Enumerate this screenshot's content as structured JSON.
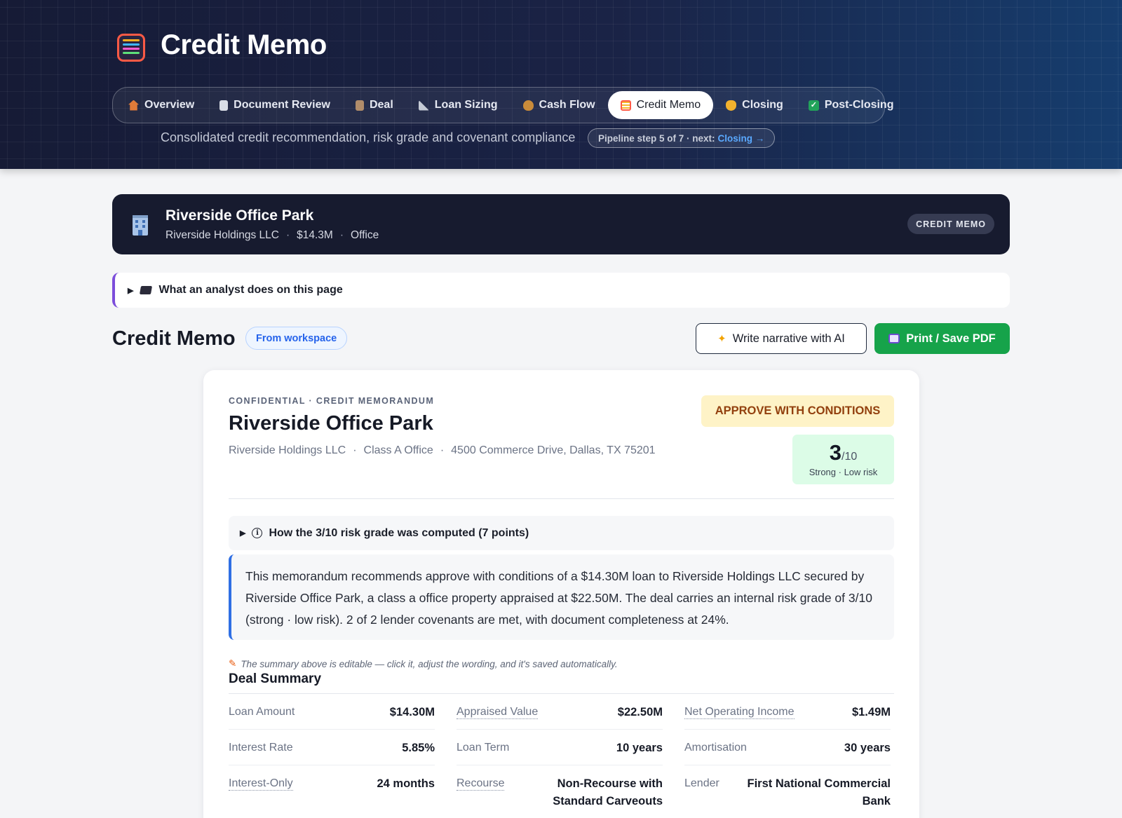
{
  "app": {
    "title": "Credit Memo"
  },
  "tabs": [
    {
      "label": "Overview",
      "icon": "house-icon",
      "active": false,
      "color": "#e07b39"
    },
    {
      "label": "Document Review",
      "icon": "document-icon",
      "active": false,
      "color": "#d9dde6"
    },
    {
      "label": "Deal",
      "icon": "clipboard-icon",
      "active": false,
      "color": "#b08c6a"
    },
    {
      "label": "Loan Sizing",
      "icon": "ruler-icon",
      "active": false,
      "color": "#c5cbd6"
    },
    {
      "label": "Cash Flow",
      "icon": "money-bag-icon",
      "active": false,
      "color": "#c98b3a"
    },
    {
      "label": "Credit Memo",
      "icon": "abacus-icon",
      "active": true,
      "color": "#ff5a45"
    },
    {
      "label": "Closing",
      "icon": "handshake-icon",
      "active": false,
      "color": "#f2b22e"
    },
    {
      "label": "Post-Closing",
      "icon": "check-icon",
      "active": false,
      "color": "#22a35a"
    }
  ],
  "header": {
    "subtitle": "Consolidated credit recommendation, risk grade and covenant compliance",
    "pipeline_text": "Pipeline step 5 of 7 · next:",
    "pipeline_next": "Closing →"
  },
  "property": {
    "name": "Riverside Office Park",
    "owner": "Riverside Holdings LLC",
    "amount": "$14.3M",
    "type": "Office",
    "chip": "CREDIT MEMO"
  },
  "analyst": {
    "label": "What an analyst does on this page"
  },
  "section": {
    "title": "Credit Memo",
    "workspace_pill": "From workspace",
    "ai_button": "Write narrative with AI",
    "print_button": "Print / Save PDF"
  },
  "memo": {
    "eyebrow": "CONFIDENTIAL · CREDIT MEMORANDUM",
    "title": "Riverside Office Park",
    "owner": "Riverside Holdings LLC",
    "class": "Class A Office",
    "address": "4500 Commerce Drive, Dallas, TX 75201",
    "recommendation": "APPROVE WITH CONDITIONS",
    "grade": "3",
    "grade_den": "/10",
    "grade_label": "Strong · Low risk",
    "grade_disclosure": "How the 3/10 risk grade was computed (7 points)",
    "summary": "This memorandum recommends approve with conditions of a $14.30M loan to Riverside Holdings LLC secured by Riverside Office Park, a class a office property appraised at $22.50M. The deal carries an internal risk grade of 3/10 (strong · low risk). 2 of 2 lender covenants are met, with document completeness at 24%.",
    "edit_note": "The summary above is editable — click it, adjust the wording, and it's saved automatically.",
    "deal_summary_title": "Deal Summary"
  },
  "deal_summary": [
    {
      "label": "Loan Amount",
      "value": "$14.30M",
      "dotted": false
    },
    {
      "label": "Appraised Value",
      "value": "$22.50M",
      "dotted": true
    },
    {
      "label": "Net Operating Income",
      "value": "$1.49M",
      "dotted": true
    },
    {
      "label": "Interest Rate",
      "value": "5.85%",
      "dotted": false
    },
    {
      "label": "Loan Term",
      "value": "10 years",
      "dotted": false
    },
    {
      "label": "Amortisation",
      "value": "30 years",
      "dotted": false
    },
    {
      "label": "Interest-Only",
      "value": "24 months",
      "dotted": true
    },
    {
      "label": "Recourse",
      "value": "Non-Recourse with Standard Carveouts",
      "dotted": true
    },
    {
      "label": "Lender",
      "value": "First National Commercial Bank",
      "dotted": false
    }
  ],
  "colors": {
    "accent_blue": "#2f6fe4",
    "approve_bg": "#fef3c7",
    "approve_text": "#92400e",
    "grade_bg": "#dcfce7",
    "print_green": "#16a34a",
    "analyst_purple": "#7c4ddb"
  }
}
